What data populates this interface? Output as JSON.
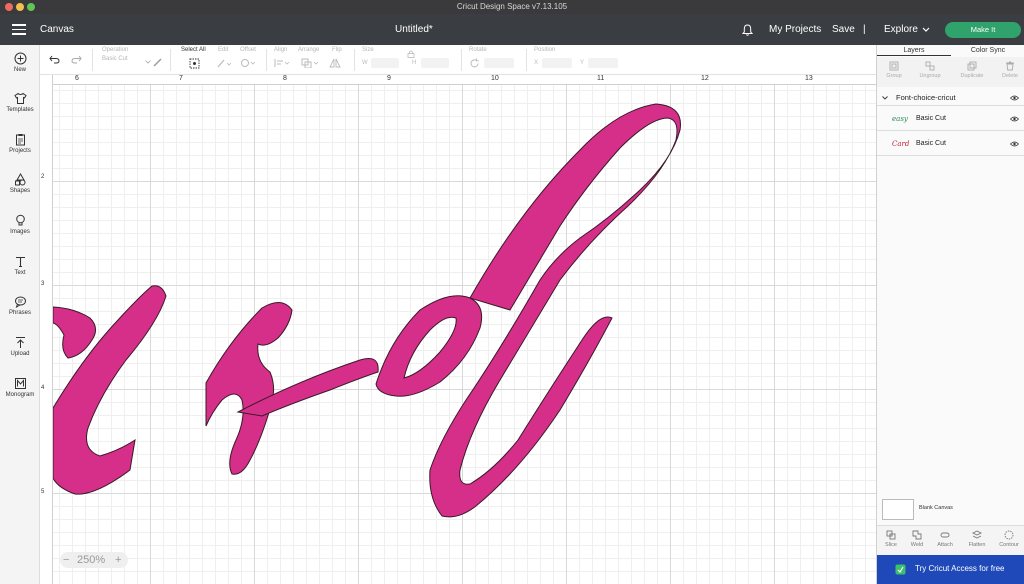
{
  "window": {
    "title": "Cricut Design Space  v7.13.105"
  },
  "appbar": {
    "section": "Canvas",
    "doc_title": "Untitled*",
    "my_projects": "My Projects",
    "save": "Save",
    "separator": "|",
    "explore": "Explore",
    "make_it": "Make It"
  },
  "toolbar": {
    "operation_label": "Operation",
    "operation_value": "Basic Cut",
    "select_all_label": "Select All",
    "edit_label": "Edit",
    "offset_label": "Offset",
    "align_label": "Align",
    "arrange_label": "Arrange",
    "flip_label": "Flip",
    "size_label": "Size",
    "size_w": "W",
    "size_h": "H",
    "rotate_label": "Rotate",
    "position_label": "Position",
    "pos_x": "X",
    "pos_y": "Y"
  },
  "leftbar": {
    "items": [
      {
        "label": "New",
        "icon": "plus-circle-icon"
      },
      {
        "label": "Templates",
        "icon": "shirt-icon"
      },
      {
        "label": "Projects",
        "icon": "clipboard-icon"
      },
      {
        "label": "Shapes",
        "icon": "shapes-icon"
      },
      {
        "label": "Images",
        "icon": "bulb-icon"
      },
      {
        "label": "Text",
        "icon": "text-icon"
      },
      {
        "label": "Phrases",
        "icon": "speech-bubble-icon"
      },
      {
        "label": "Upload",
        "icon": "upload-icon"
      },
      {
        "label": "Monogram",
        "icon": "monogram-icon"
      }
    ]
  },
  "ruler": {
    "top": [
      "6",
      "7",
      "8",
      "9",
      "10",
      "11",
      "12",
      "13"
    ],
    "left": [
      "2",
      "3",
      "4",
      "5"
    ]
  },
  "canvas": {
    "zoom": "250%",
    "zoom_minus": "−",
    "zoom_plus": "+",
    "text_color": "#d62f8a",
    "grid_major": "#d9d9d9",
    "grid_minor": "#efefef"
  },
  "rightpanel": {
    "tabs": [
      "Layers",
      "Color Sync"
    ],
    "actions": [
      "Group",
      "Ungroup",
      "Duplicate",
      "Delete"
    ],
    "group_name": "Font-choice-cricut",
    "layers": [
      {
        "thumb": "easy",
        "name": "Basic Cut",
        "thumb_color": "#2b8a57"
      },
      {
        "thumb": "Card",
        "name": "Basic Cut",
        "thumb_color": "#c0203a"
      }
    ],
    "blank_canvas": "Blank Canvas",
    "bottom_actions": [
      "Slice",
      "Weld",
      "Attach",
      "Flatten",
      "Contour"
    ],
    "cricut_access": "Try Cricut Access for free"
  }
}
